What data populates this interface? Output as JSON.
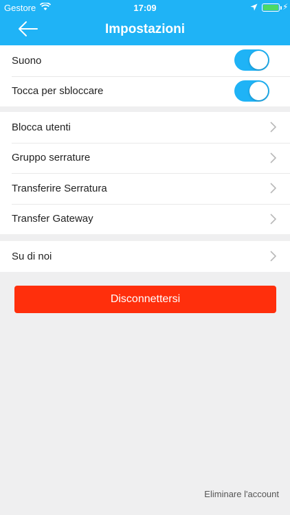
{
  "status_bar": {
    "carrier": "Gestore",
    "time": "17:09",
    "bolt": "⚡"
  },
  "header": {
    "title": "Impostazioni"
  },
  "toggles": [
    {
      "label": "Suono",
      "on": true
    },
    {
      "label": "Tocca per sbloccare",
      "on": true
    }
  ],
  "menu": [
    {
      "label": "Blocca utenti"
    },
    {
      "label": "Gruppo serrature"
    },
    {
      "label": "Transferire Serratura"
    },
    {
      "label": "Transfer Gateway"
    }
  ],
  "about": {
    "label": "Su di noi"
  },
  "logout": {
    "label": "Disconnettersi"
  },
  "delete_account": {
    "label": "Eliminare l'account"
  },
  "colors": {
    "accent": "#1fb3f6",
    "danger": "#ff2f0c",
    "background": "#efeff0"
  }
}
